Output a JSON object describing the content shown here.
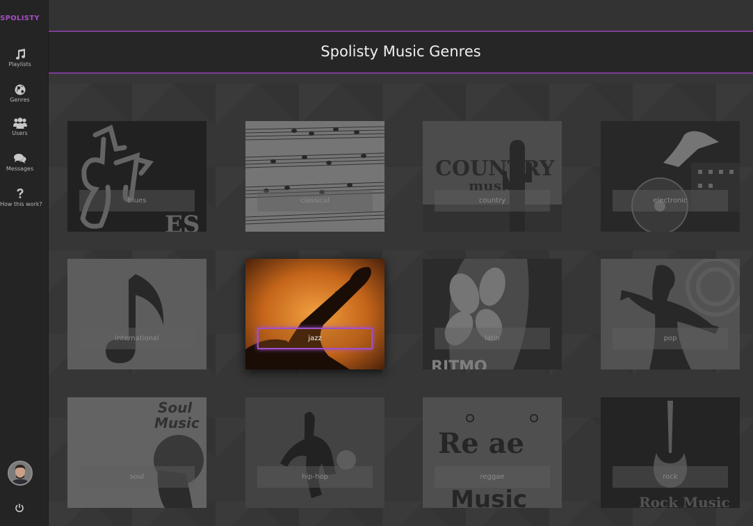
{
  "app": {
    "brand": "SPOLISTY",
    "page_title": "Spolisty Music Genres",
    "accent_color": "#7d3d98"
  },
  "sidebar": {
    "items": [
      {
        "label": "Playlists",
        "icon": "music-note-icon"
      },
      {
        "label": "Genres",
        "icon": "globe-icon"
      },
      {
        "label": "Users",
        "icon": "users-icon"
      },
      {
        "label": "Messages",
        "icon": "comments-icon"
      },
      {
        "label": "How this work?",
        "icon": "question-icon"
      }
    ],
    "avatar_icon": "user-avatar",
    "logout_icon": "power-icon"
  },
  "genres": [
    {
      "label": "blues"
    },
    {
      "label": "classical"
    },
    {
      "label": "country"
    },
    {
      "label": "electronic"
    },
    {
      "label": "international"
    },
    {
      "label": "jazz",
      "active": true
    },
    {
      "label": "latin"
    },
    {
      "label": "pop"
    },
    {
      "label": "soul"
    },
    {
      "label": "hip-hop"
    },
    {
      "label": "reggae"
    },
    {
      "label": "rock"
    }
  ],
  "art_text": {
    "blues": "ES",
    "country_1": "COUNTRY",
    "country_2": "music",
    "latin": "RITMO",
    "soul_1": "Soul",
    "soul_2": "Music",
    "reggae_1": "Re  ae",
    "reggae_2": "Music",
    "rock": "Rock Music"
  }
}
